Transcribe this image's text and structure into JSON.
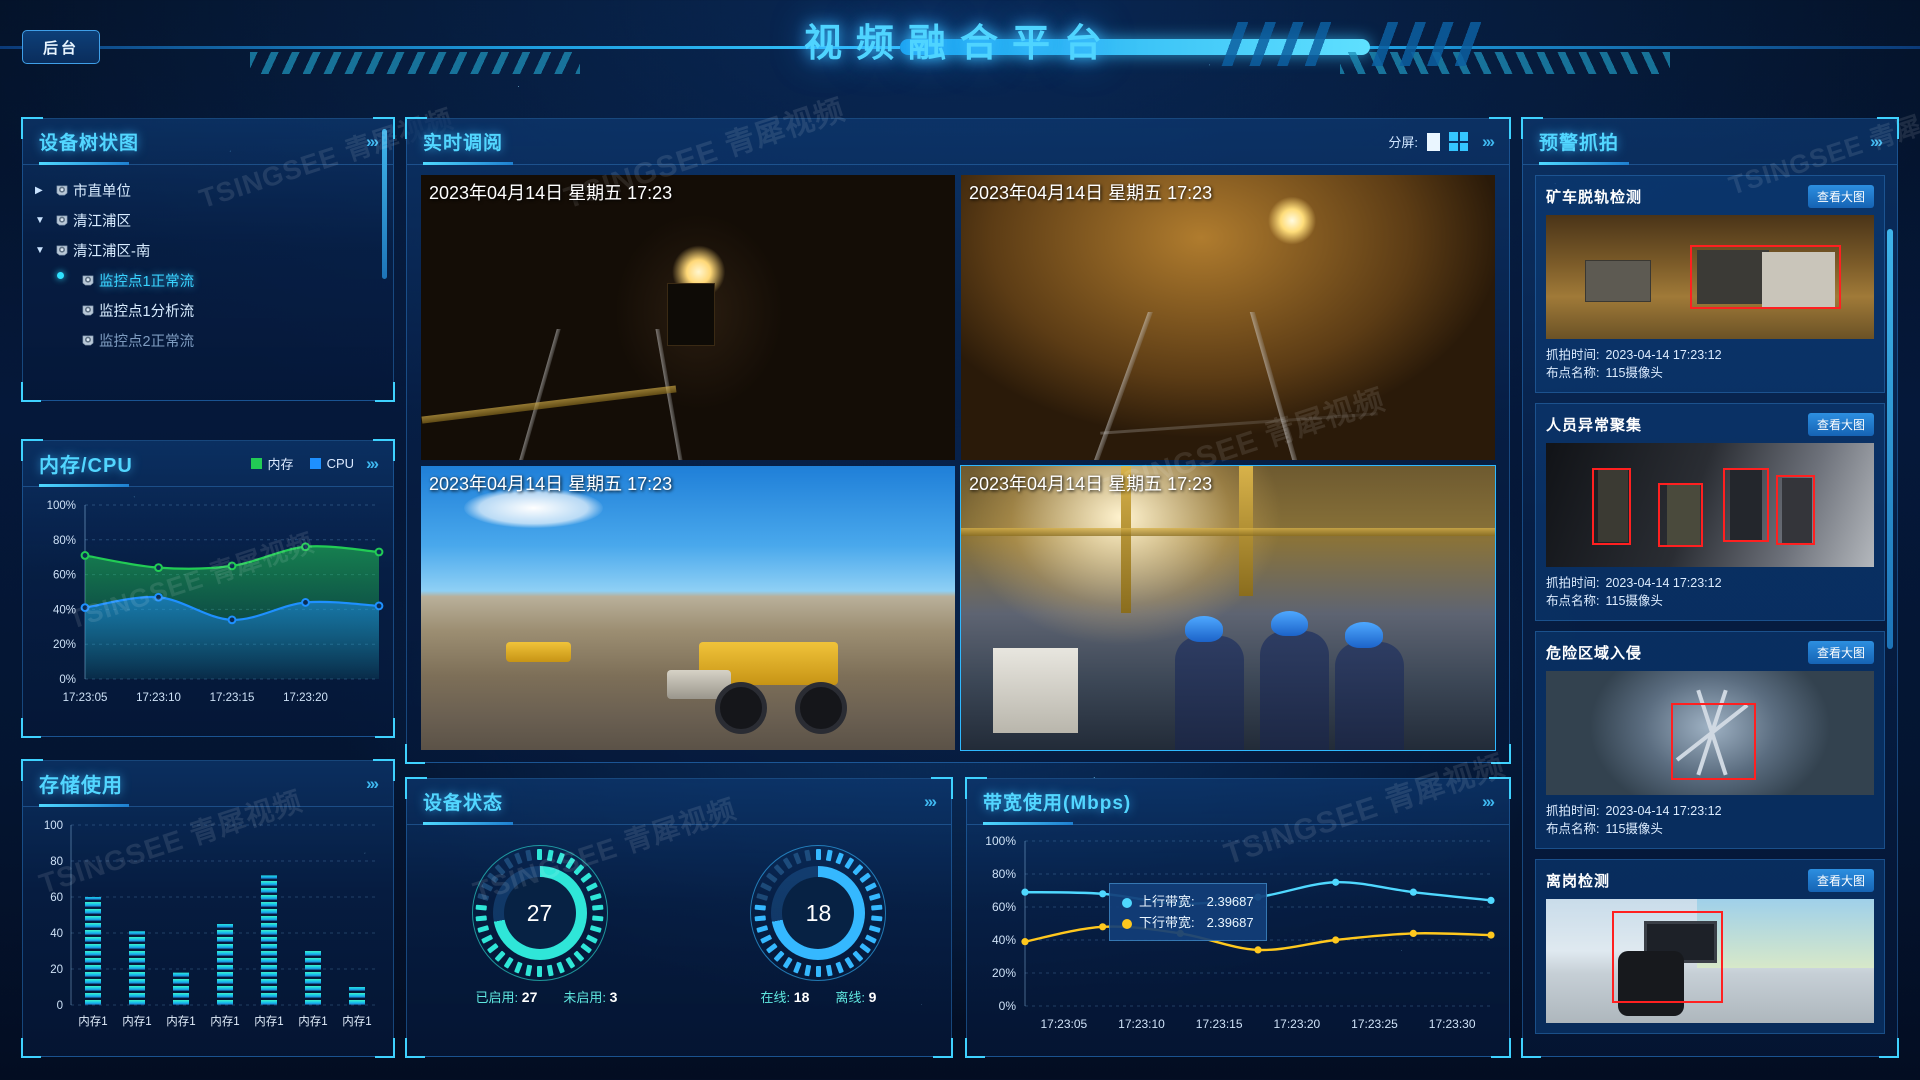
{
  "header": {
    "title": "视频融合平台",
    "back_button": "后台"
  },
  "device_tree": {
    "title": "设备树状图",
    "more": "›››",
    "nodes": [
      {
        "label": "市直单位",
        "caret": "▶",
        "level": 0,
        "state": "normal"
      },
      {
        "label": "清江浦区",
        "caret": "▼",
        "level": 0,
        "state": "normal"
      },
      {
        "label": "清江浦区-南",
        "caret": "▼",
        "level": 0,
        "state": "normal"
      },
      {
        "label": "监控点1正常流",
        "caret": "",
        "level": 1,
        "state": "selected"
      },
      {
        "label": "监控点1分析流",
        "caret": "",
        "level": 1,
        "state": "normal"
      },
      {
        "label": "监控点2正常流",
        "caret": "",
        "level": 1,
        "state": "dim"
      }
    ]
  },
  "memcpu": {
    "title": "内存/CPU",
    "more": "›››",
    "legend": [
      {
        "name": "内存",
        "color": "#22cc55"
      },
      {
        "name": "CPU",
        "color": "#1e90ff"
      }
    ]
  },
  "storage": {
    "title": "存储使用",
    "more": "›››"
  },
  "live": {
    "title": "实时调阅",
    "split_label": "分屏:",
    "more": "›››",
    "cells": [
      {
        "timestamp": "2023年04月14日 星期五 17:23",
        "scene": "tunnel1",
        "selected": false
      },
      {
        "timestamp": "2023年04月14日 星期五 17:23",
        "scene": "tunnel2",
        "selected": false
      },
      {
        "timestamp": "2023年04月14日 星期五 17:23",
        "scene": "mine",
        "selected": false
      },
      {
        "timestamp": "2023年04月14日 星期五 17:23",
        "scene": "indoor",
        "selected": true
      }
    ]
  },
  "device_status": {
    "title": "设备状态",
    "more": "›››",
    "gauges": [
      {
        "value": "27",
        "color": "#2fe6d8",
        "labels": [
          {
            "name": "已启用:",
            "value": "27"
          },
          {
            "name": "未启用:",
            "value": "3"
          }
        ]
      },
      {
        "value": "18",
        "color": "#35b8ff",
        "labels": [
          {
            "name": "在线:",
            "value": "18"
          },
          {
            "name": "离线:",
            "value": "9"
          }
        ]
      }
    ]
  },
  "bandwidth": {
    "title": "带宽使用(Mbps)",
    "more": "›››",
    "tooltip": [
      {
        "name": "上行带宽:",
        "value": "2.39687",
        "color": "#4fd8ff"
      },
      {
        "name": "下行带宽:",
        "value": "2.39687",
        "color": "#ffc81e"
      }
    ]
  },
  "alarms": {
    "title": "预警抓拍",
    "more": "›››",
    "view_label": "查看大图",
    "time_label": "抓拍时间:",
    "point_label": "布点名称:",
    "cards": [
      {
        "name": "矿车脱轨检测",
        "time": "2023-04-14  17:23:12",
        "point": "115摄像头",
        "scene": "cart"
      },
      {
        "name": "人员异常聚集",
        "time": "2023-04-14  17:23:12",
        "point": "115摄像头",
        "scene": "crowd"
      },
      {
        "name": "危险区域入侵",
        "time": "2023-04-14  17:23:12",
        "point": "115摄像头",
        "scene": "turbine"
      },
      {
        "name": "离岗检测",
        "time": "",
        "point": "",
        "scene": "desk"
      }
    ]
  },
  "watermark": "TSINGSEE 青犀视频",
  "chart_data": [
    {
      "type": "area",
      "id": "memcpu",
      "title": "内存/CPU",
      "x": [
        "17:23:05",
        "17:23:10",
        "17:23:15",
        "17:23:20"
      ],
      "ylim": [
        0,
        100
      ],
      "yticks": [
        "0%",
        "20%",
        "40%",
        "60%",
        "80%",
        "100%"
      ],
      "grid": true,
      "legend_position": "top-right",
      "series": [
        {
          "name": "内存",
          "color": "#22cc55",
          "values": [
            71,
            64,
            65,
            76,
            73
          ]
        },
        {
          "name": "CPU",
          "color": "#1e90ff",
          "values": [
            41,
            47,
            34,
            44,
            42
          ]
        }
      ]
    },
    {
      "type": "bar",
      "id": "storage",
      "title": "存储使用",
      "categories": [
        "内存1",
        "内存1",
        "内存1",
        "内存1",
        "内存1",
        "内存1",
        "内存1"
      ],
      "values": [
        60,
        41,
        18,
        45,
        72,
        30,
        10
      ],
      "ylim": [
        0,
        100
      ],
      "yticks": [
        "0",
        "20",
        "40",
        "60",
        "80",
        "100"
      ],
      "grid": true
    },
    {
      "type": "line",
      "id": "bandwidth",
      "title": "带宽使用(Mbps)",
      "x": [
        "17:23:05",
        "17:23:10",
        "17:23:15",
        "17:23:20",
        "17:23:25",
        "17:23:30"
      ],
      "ylim": [
        0,
        100
      ],
      "yticks": [
        "0%",
        "20%",
        "40%",
        "60%",
        "80%",
        "100%"
      ],
      "grid": true,
      "series": [
        {
          "name": "上行带宽",
          "color": "#4fd8ff",
          "values": [
            69,
            68,
            62,
            66,
            75,
            69,
            64
          ]
        },
        {
          "name": "下行带宽",
          "color": "#ffc81e",
          "values": [
            39,
            48,
            44,
            34,
            40,
            44,
            43
          ]
        }
      ]
    },
    {
      "type": "gauge",
      "id": "device-status",
      "title": "设备状态",
      "gauges": [
        {
          "label": "已启用",
          "value": 27,
          "secondary_label": "未启用",
          "secondary_value": 3
        },
        {
          "label": "在线",
          "value": 18,
          "secondary_label": "离线",
          "secondary_value": 9
        }
      ]
    }
  ]
}
